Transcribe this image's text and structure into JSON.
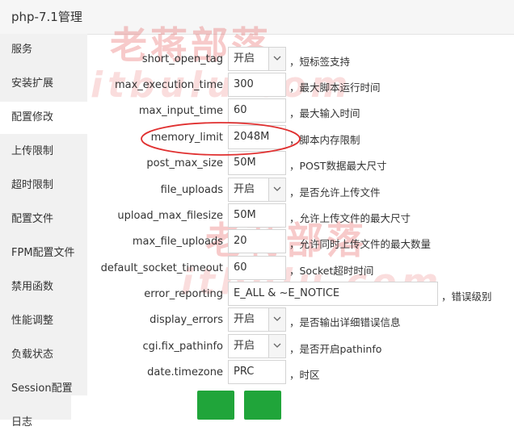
{
  "window": {
    "title": "php-7.1管理"
  },
  "sidebar": {
    "items": [
      {
        "label": "服务"
      },
      {
        "label": "安装扩展"
      },
      {
        "label": "配置修改"
      },
      {
        "label": "上传限制"
      },
      {
        "label": "超时限制"
      },
      {
        "label": "配置文件"
      },
      {
        "label": "FPM配置文件"
      },
      {
        "label": "禁用函数"
      },
      {
        "label": "性能调整"
      },
      {
        "label": "负载状态"
      },
      {
        "label": "Session配置"
      },
      {
        "label": "日志"
      }
    ],
    "active_index": 2
  },
  "settings": [
    {
      "label": "short_open_tag",
      "value": "开启",
      "type": "select",
      "desc": "，短标签支持"
    },
    {
      "label": "max_execution_time",
      "value": "300",
      "type": "input",
      "desc": "，最大脚本运行时间"
    },
    {
      "label": "max_input_time",
      "value": "60",
      "type": "input",
      "desc": "，最大输入时间"
    },
    {
      "label": "memory_limit",
      "value": "2048M",
      "type": "input",
      "desc": "，脚本内存限制"
    },
    {
      "label": "post_max_size",
      "value": "50M",
      "type": "input",
      "desc": "，POST数据最大尺寸"
    },
    {
      "label": "file_uploads",
      "value": "开启",
      "type": "select",
      "desc": "，是否允许上传文件"
    },
    {
      "label": "upload_max_filesize",
      "value": "50M",
      "type": "input",
      "desc": "，允许上传文件的最大尺寸"
    },
    {
      "label": "max_file_uploads",
      "value": "20",
      "type": "input",
      "desc": "，允许同时上传文件的最大数量"
    },
    {
      "label": "default_socket_timeout",
      "value": "60",
      "type": "input",
      "desc": "，Socket超时时间"
    },
    {
      "label": "error_reporting",
      "value": "E_ALL & ~E_NOTICE",
      "type": "input-wide",
      "desc": "，错误级别"
    },
    {
      "label": "display_errors",
      "value": "开启",
      "type": "select",
      "desc": "，是否输出详细错误信息"
    },
    {
      "label": "cgi.fix_pathinfo",
      "value": "开启",
      "type": "select",
      "desc": "，是否开启pathinfo"
    },
    {
      "label": "date.timezone",
      "value": "PRC",
      "type": "input",
      "desc": "，时区"
    }
  ],
  "watermark": {
    "text_cn": "老蒋部落",
    "text_en": "itbulu.com"
  },
  "colors": {
    "accent": "#20a53a",
    "annotation": "#e03030",
    "sidebar_bg": "#f1f1f1"
  }
}
